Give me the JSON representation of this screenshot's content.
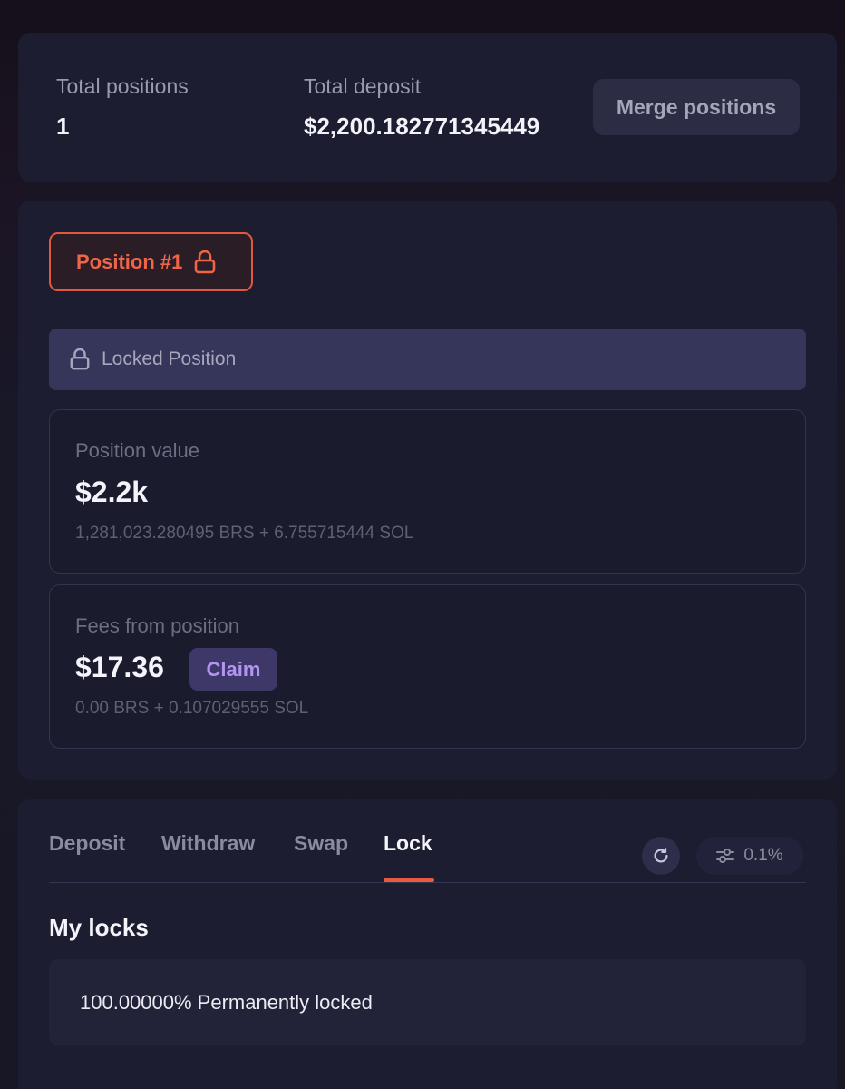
{
  "summary": {
    "total_positions_label": "Total positions",
    "total_positions_value": "1",
    "total_deposit_label": "Total deposit",
    "total_deposit_value": "$2,200.182771345449",
    "merge_label": "Merge positions"
  },
  "position": {
    "tab_label": "Position #1",
    "locked_label": "Locked Position",
    "value_label": "Position value",
    "value": "$2.2k",
    "value_breakdown": "1,281,023.280495 BRS + 6.755715444 SOL",
    "fees_label": "Fees from position",
    "fees_value": "$17.36",
    "claim_label": "Claim",
    "fees_breakdown": "0.00 BRS + 0.107029555 SOL"
  },
  "tabs": {
    "items": [
      {
        "label": "Deposit",
        "active": false
      },
      {
        "label": "Withdraw",
        "active": false
      },
      {
        "label": "Swap",
        "active": false
      },
      {
        "label": "Lock",
        "active": true
      }
    ],
    "slippage": "0.1%"
  },
  "locks": {
    "title": "My locks",
    "entry": "100.00000% Permanently locked"
  },
  "icons": {
    "position_lock": "lock-icon",
    "locked_bar": "lock-icon",
    "refresh": "refresh-icon",
    "settings": "sliders-icon"
  },
  "colors": {
    "accent": "#e85a3d",
    "claim_text": "#b394f2",
    "card_bg": "#1c1d30"
  }
}
